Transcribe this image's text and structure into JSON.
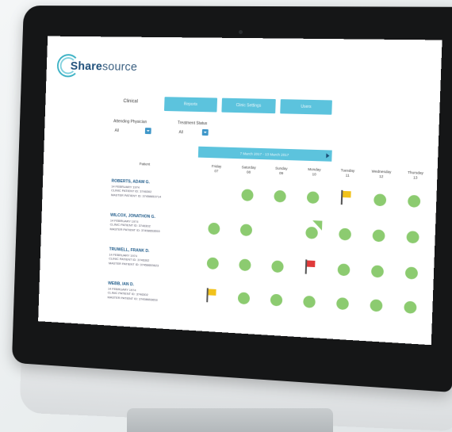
{
  "app": {
    "logo_bold": "Share",
    "logo_light": "source"
  },
  "header": {
    "section_label": "Clinical",
    "buttons": [
      "Reports",
      "Clinic Settings",
      "Users"
    ]
  },
  "filters": {
    "physician_label": "Attending Physician",
    "physician_value": "All",
    "status_label": "Treatment Status",
    "status_value": "All"
  },
  "date_range": {
    "label": "7 March 2017 - 13 March 2017"
  },
  "table": {
    "patient_header": "Patient",
    "days": [
      {
        "name": "Friday",
        "date": "07"
      },
      {
        "name": "Saturday",
        "date": "08"
      },
      {
        "name": "Sunday",
        "date": "09"
      },
      {
        "name": "Monday",
        "date": "10"
      },
      {
        "name": "Tuesday",
        "date": "11"
      },
      {
        "name": "Wednesday",
        "date": "12"
      },
      {
        "name": "Thursday",
        "date": "13"
      }
    ],
    "rows": [
      {
        "name": "ROBERTS, ADAM G.",
        "line1": "14 FEBRUARY 1974",
        "line2": "CLINIC PATIENT ID: 3746302",
        "line3": "MASTER PATIENT ID: 37458653714",
        "cells": [
          "",
          "dot",
          "dot",
          "dot",
          "flag-yellow-1",
          "dot",
          "dot"
        ]
      },
      {
        "name": "WILCOX, JONATHON G.",
        "line1": "14 FEBRUARY 1974",
        "line2": "CLINIC PATIENT ID: 3746302",
        "line3": "MASTER PATIENT ID: 37458653553",
        "cells": [
          "dot",
          "dot",
          "",
          "dot-corner",
          "dot",
          "dot",
          "dot"
        ]
      },
      {
        "name": "TRUWELL, FRANK D.",
        "line1": "14 FEBRUARY 1974",
        "line2": "CLINIC PATIENT ID: 3746302",
        "line3": "MASTER PATIENT ID: 37458653623",
        "cells": [
          "dot",
          "dot",
          "dot",
          "flag-red",
          "dot",
          "dot",
          "dot"
        ]
      },
      {
        "name": "WEBB, IAN D.",
        "line1": "14 FEBRUARY 1974",
        "line2": "CLINIC PATIENT ID: 3746302",
        "line3": "MASTER PATIENT ID: 37458653653",
        "cells": [
          "flag-yellow-1",
          "dot",
          "dot",
          "dot",
          "dot",
          "dot",
          "dot"
        ]
      }
    ]
  },
  "colors": {
    "accent": "#5cc3dd",
    "brand": "#1e4f7a",
    "status_ok": "#8ccb70",
    "flag_warning": "#f1c21b",
    "flag_alert": "#e03a3a"
  }
}
